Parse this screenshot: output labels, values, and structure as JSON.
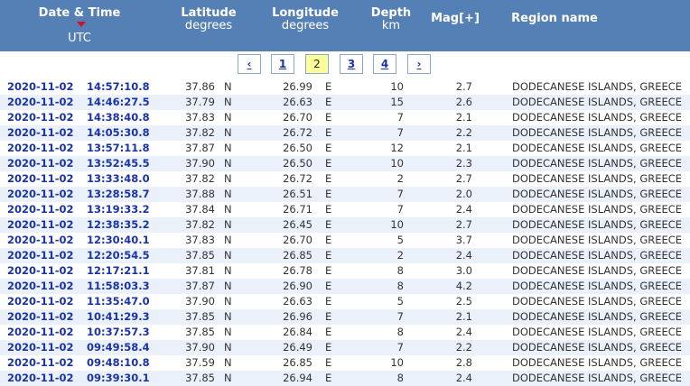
{
  "header": {
    "date_time": "Date & Time",
    "date_time_unit": "UTC",
    "latitude": "Latitude",
    "latitude_unit": "degrees",
    "longitude": "Longitude",
    "longitude_unit": "degrees",
    "depth": "Depth",
    "depth_unit": "km",
    "mag": "Mag[+]",
    "region": "Region name"
  },
  "pager": {
    "prev": "‹",
    "pages": [
      "1",
      "2",
      "3",
      "4"
    ],
    "current": "2",
    "next": "›"
  },
  "colors": {
    "header_bg": "#5580b5",
    "link": "#1a33a6",
    "row_alt": "#eaf1fb",
    "current_page": "#ffff99",
    "sort_arrow": "#d0102a"
  },
  "rows": [
    {
      "date": "2020-11-02",
      "time": "14:57:10.8",
      "lat": "37.86",
      "ns": "N",
      "lon": "26.99",
      "ew": "E",
      "depth": "10",
      "mag": "2.7",
      "region": "DODECANESE ISLANDS, GREECE"
    },
    {
      "date": "2020-11-02",
      "time": "14:46:27.5",
      "lat": "37.79",
      "ns": "N",
      "lon": "26.63",
      "ew": "E",
      "depth": "15",
      "mag": "2.6",
      "region": "DODECANESE ISLANDS, GREECE"
    },
    {
      "date": "2020-11-02",
      "time": "14:38:40.8",
      "lat": "37.83",
      "ns": "N",
      "lon": "26.70",
      "ew": "E",
      "depth": "7",
      "mag": "2.1",
      "region": "DODECANESE ISLANDS, GREECE"
    },
    {
      "date": "2020-11-02",
      "time": "14:05:30.8",
      "lat": "37.82",
      "ns": "N",
      "lon": "26.72",
      "ew": "E",
      "depth": "7",
      "mag": "2.2",
      "region": "DODECANESE ISLANDS, GREECE"
    },
    {
      "date": "2020-11-02",
      "time": "13:57:11.8",
      "lat": "37.87",
      "ns": "N",
      "lon": "26.50",
      "ew": "E",
      "depth": "12",
      "mag": "2.1",
      "region": "DODECANESE ISLANDS, GREECE"
    },
    {
      "date": "2020-11-02",
      "time": "13:52:45.5",
      "lat": "37.90",
      "ns": "N",
      "lon": "26.50",
      "ew": "E",
      "depth": "10",
      "mag": "2.3",
      "region": "DODECANESE ISLANDS, GREECE"
    },
    {
      "date": "2020-11-02",
      "time": "13:33:48.0",
      "lat": "37.82",
      "ns": "N",
      "lon": "26.72",
      "ew": "E",
      "depth": "2",
      "mag": "2.7",
      "region": "DODECANESE ISLANDS, GREECE"
    },
    {
      "date": "2020-11-02",
      "time": "13:28:58.7",
      "lat": "37.88",
      "ns": "N",
      "lon": "26.51",
      "ew": "E",
      "depth": "7",
      "mag": "2.0",
      "region": "DODECANESE ISLANDS, GREECE"
    },
    {
      "date": "2020-11-02",
      "time": "13:19:33.2",
      "lat": "37.84",
      "ns": "N",
      "lon": "26.71",
      "ew": "E",
      "depth": "7",
      "mag": "2.4",
      "region": "DODECANESE ISLANDS, GREECE"
    },
    {
      "date": "2020-11-02",
      "time": "12:38:35.2",
      "lat": "37.82",
      "ns": "N",
      "lon": "26.45",
      "ew": "E",
      "depth": "10",
      "mag": "2.7",
      "region": "DODECANESE ISLANDS, GREECE"
    },
    {
      "date": "2020-11-02",
      "time": "12:30:40.1",
      "lat": "37.83",
      "ns": "N",
      "lon": "26.70",
      "ew": "E",
      "depth": "5",
      "mag": "3.7",
      "region": "DODECANESE ISLANDS, GREECE"
    },
    {
      "date": "2020-11-02",
      "time": "12:20:54.5",
      "lat": "37.85",
      "ns": "N",
      "lon": "26.85",
      "ew": "E",
      "depth": "2",
      "mag": "2.4",
      "region": "DODECANESE ISLANDS, GREECE"
    },
    {
      "date": "2020-11-02",
      "time": "12:17:21.1",
      "lat": "37.81",
      "ns": "N",
      "lon": "26.78",
      "ew": "E",
      "depth": "8",
      "mag": "3.0",
      "region": "DODECANESE ISLANDS, GREECE"
    },
    {
      "date": "2020-11-02",
      "time": "11:58:03.3",
      "lat": "37.87",
      "ns": "N",
      "lon": "26.90",
      "ew": "E",
      "depth": "8",
      "mag": "4.2",
      "region": "DODECANESE ISLANDS, GREECE"
    },
    {
      "date": "2020-11-02",
      "time": "11:35:47.0",
      "lat": "37.90",
      "ns": "N",
      "lon": "26.63",
      "ew": "E",
      "depth": "5",
      "mag": "2.5",
      "region": "DODECANESE ISLANDS, GREECE"
    },
    {
      "date": "2020-11-02",
      "time": "10:41:29.3",
      "lat": "37.85",
      "ns": "N",
      "lon": "26.96",
      "ew": "E",
      "depth": "7",
      "mag": "2.1",
      "region": "DODECANESE ISLANDS, GREECE"
    },
    {
      "date": "2020-11-02",
      "time": "10:37:57.3",
      "lat": "37.85",
      "ns": "N",
      "lon": "26.84",
      "ew": "E",
      "depth": "8",
      "mag": "2.4",
      "region": "DODECANESE ISLANDS, GREECE"
    },
    {
      "date": "2020-11-02",
      "time": "09:49:58.4",
      "lat": "37.90",
      "ns": "N",
      "lon": "26.49",
      "ew": "E",
      "depth": "7",
      "mag": "2.2",
      "region": "DODECANESE ISLANDS, GREECE"
    },
    {
      "date": "2020-11-02",
      "time": "09:48:10.8",
      "lat": "37.59",
      "ns": "N",
      "lon": "26.85",
      "ew": "E",
      "depth": "10",
      "mag": "2.8",
      "region": "DODECANESE ISLANDS, GREECE"
    },
    {
      "date": "2020-11-02",
      "time": "09:39:30.1",
      "lat": "37.85",
      "ns": "N",
      "lon": "26.94",
      "ew": "E",
      "depth": "8",
      "mag": "2.4",
      "region": "DODECANESE ISLANDS, GREECE"
    }
  ]
}
